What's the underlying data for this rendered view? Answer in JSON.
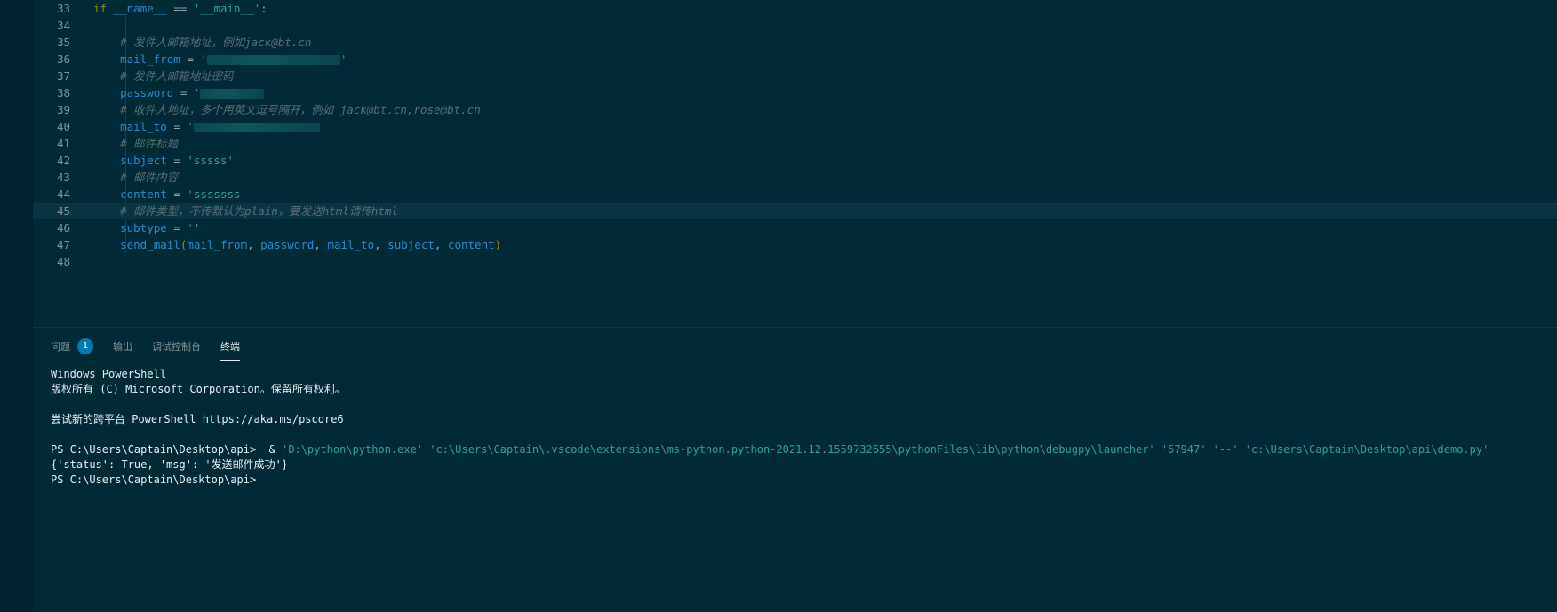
{
  "editor": {
    "lines": [
      {
        "num": "33",
        "tokens": [
          {
            "t": "if ",
            "c": "kw"
          },
          {
            "t": "__name__",
            "c": "var"
          },
          {
            "t": " == ",
            "c": "op"
          },
          {
            "t": "'__main__'",
            "c": "str"
          },
          {
            "t": ":",
            "c": "op"
          }
        ]
      },
      {
        "num": "34",
        "tokens": []
      },
      {
        "num": "35",
        "tokens": [
          {
            "t": "    # 发件人邮箱地址，例如jack@bt.cn",
            "c": "cmt"
          }
        ]
      },
      {
        "num": "36",
        "tokens": [
          {
            "t": "    mail_from",
            "c": "var"
          },
          {
            "t": " = ",
            "c": "op"
          },
          {
            "t": "'",
            "c": "str"
          },
          {
            "t": "",
            "c": "redact"
          },
          {
            "t": "'",
            "c": "str"
          }
        ]
      },
      {
        "num": "37",
        "tokens": [
          {
            "t": "    # 发件人邮箱地址密码",
            "c": "cmt"
          }
        ]
      },
      {
        "num": "38",
        "tokens": [
          {
            "t": "    password",
            "c": "var"
          },
          {
            "t": " = ",
            "c": "op"
          },
          {
            "t": "'",
            "c": "str"
          },
          {
            "t": "",
            "c": "redact-short"
          }
        ]
      },
      {
        "num": "39",
        "tokens": [
          {
            "t": "    # 收件人地址，多个用英文逗号隔开，例如 jack@bt.cn,rose@bt.cn",
            "c": "cmt"
          }
        ]
      },
      {
        "num": "40",
        "tokens": [
          {
            "t": "    mail_to",
            "c": "var"
          },
          {
            "t": " = ",
            "c": "op"
          },
          {
            "t": "'",
            "c": "str"
          },
          {
            "t": "",
            "c": "redact-mid"
          }
        ]
      },
      {
        "num": "41",
        "tokens": [
          {
            "t": "    # 邮件标题",
            "c": "cmt"
          }
        ]
      },
      {
        "num": "42",
        "tokens": [
          {
            "t": "    subject",
            "c": "var"
          },
          {
            "t": " = ",
            "c": "op"
          },
          {
            "t": "'sssss'",
            "c": "str"
          }
        ]
      },
      {
        "num": "43",
        "tokens": [
          {
            "t": "    # 邮件内容",
            "c": "cmt"
          }
        ]
      },
      {
        "num": "44",
        "tokens": [
          {
            "t": "    content",
            "c": "var"
          },
          {
            "t": " = ",
            "c": "op"
          },
          {
            "t": "'sssssss'",
            "c": "str"
          }
        ]
      },
      {
        "num": "45",
        "tokens": [
          {
            "t": "    # 邮件类型，不传默认为plain，要发送html请传html",
            "c": "cmt"
          }
        ],
        "active": true
      },
      {
        "num": "46",
        "tokens": [
          {
            "t": "    subtype",
            "c": "var"
          },
          {
            "t": " = ",
            "c": "op"
          },
          {
            "t": "''",
            "c": "str"
          }
        ]
      },
      {
        "num": "47",
        "tokens": [
          {
            "t": "    send_mail",
            "c": "var"
          },
          {
            "t": "(",
            "c": "paren"
          },
          {
            "t": "mail_from",
            "c": "var"
          },
          {
            "t": ", ",
            "c": "op"
          },
          {
            "t": "password",
            "c": "var"
          },
          {
            "t": ", ",
            "c": "op"
          },
          {
            "t": "mail_to",
            "c": "var"
          },
          {
            "t": ", ",
            "c": "op"
          },
          {
            "t": "subject",
            "c": "var"
          },
          {
            "t": ", ",
            "c": "op"
          },
          {
            "t": "content",
            "c": "var"
          },
          {
            "t": ")",
            "c": "paren"
          }
        ]
      },
      {
        "num": "48",
        "tokens": []
      }
    ]
  },
  "panel": {
    "tabs": [
      {
        "label": "问题",
        "badge": "1",
        "active": false
      },
      {
        "label": "输出",
        "active": false
      },
      {
        "label": "调试控制台",
        "active": false
      },
      {
        "label": "终端",
        "active": true
      }
    ]
  },
  "terminal": {
    "line1": "Windows PowerShell",
    "line2": "版权所有 (C) Microsoft Corporation。保留所有权利。",
    "line3": "尝试新的跨平台 PowerShell https://aka.ms/pscore6",
    "prompt1": "PS C:\\Users\\Captain\\Desktop\\api>  & ",
    "command": "'D:\\python\\python.exe' 'c:\\Users\\Captain\\.vscode\\extensions\\ms-python.python-2021.12.1559732655\\pythonFiles\\lib\\python\\debugpy\\launcher' '57947' '--' 'c:\\Users\\Captain\\Desktop\\api\\demo.py'",
    "output": "{'status': True, 'msg': '发送邮件成功'}",
    "prompt2": "PS C:\\Users\\Captain\\Desktop\\api>"
  }
}
